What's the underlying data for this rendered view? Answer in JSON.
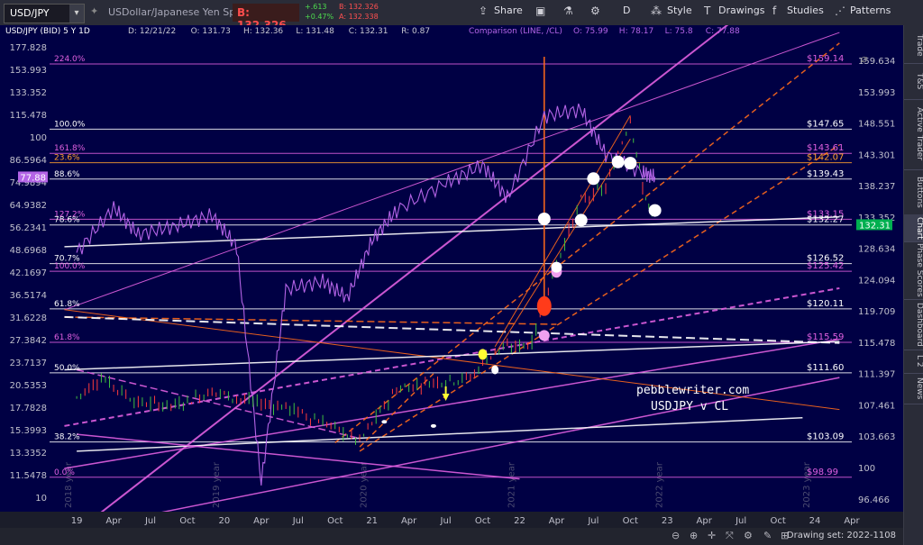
{
  "toolbar": {
    "symbol": "USD/JPY",
    "description": "USDollar/Japanese Yen Spot",
    "bid_label": "B: 132.326",
    "change_abs": "+.613",
    "change_pct": "+0.47%",
    "bid_small": "B: 132.326",
    "ask_small": "A: 132.338",
    "share_label": "Share",
    "interval_label": "D",
    "style_label": "Style",
    "drawings_label": "Drawings",
    "studies_label": "Studies",
    "patterns_label": "Patterns"
  },
  "sidebar": {
    "tabs": [
      "Trade",
      "T&S",
      "Active Trader",
      "Buttons",
      "Chart",
      "Phase Scores",
      "Dashboard",
      "L 2",
      "News"
    ]
  },
  "status": {
    "drawing_set": "Drawing set: 2022-1108"
  },
  "colors": {
    "background": "#000044",
    "price_up": "#3fbf3f",
    "price_down": "#ff3b3b",
    "comparison": "#b464e6",
    "fib_magenta": "#e060e0",
    "trend_orange": "#ff6a1a",
    "white": "#ffffff"
  },
  "chart_data": {
    "type": "line",
    "title": "USD/JPY (BID) 5 Y 1D",
    "ohlc_readout": {
      "D": "12/21/22",
      "O": "131.73",
      "H": "132.36",
      "L": "131.48",
      "C": "132.31",
      "R": "0.87"
    },
    "comparison_label": "Comparison (LINE, /CL)",
    "comparison_readout": {
      "O": "75.99",
      "H": "78.17",
      "L": "75.8",
      "C": "77.88"
    },
    "y_scale": "log",
    "x_ticks": [
      "19",
      "Apr",
      "Jul",
      "Oct",
      "20",
      "Apr",
      "Jul",
      "Oct",
      "21",
      "Apr",
      "Jul",
      "Oct",
      "22",
      "Apr",
      "Jul",
      "Oct",
      "23",
      "Apr",
      "Jul",
      "Oct",
      "24",
      "Apr"
    ],
    "year_watermarks": [
      "2018 year",
      "2019 year",
      "2020 year",
      "2021 year",
      "2022 year",
      "2023 year"
    ],
    "left_axis_ticks": [
      "177.828",
      "153.993",
      "133.352",
      "115.478",
      "100",
      "86.5964",
      "74.9894",
      "64.9382",
      "56.2341",
      "48.6968",
      "42.1697",
      "36.5174",
      "31.6228",
      "27.3842",
      "23.7137",
      "20.5353",
      "17.7828",
      "15.3993",
      "13.3352",
      "11.5478",
      "10"
    ],
    "left_axis_marker": "77.88",
    "right_axis_ticks": [
      "159.634",
      "153.993",
      "148.551",
      "143.301",
      "138.237",
      "133.352",
      "128.634",
      "124.094",
      "119.709",
      "115.478",
      "111.397",
      "107.461",
      "103.663",
      "100",
      "96.466"
    ],
    "right_axis_marker": "132.31",
    "fib_levels": [
      {
        "pct": "224.0%",
        "value": "$159.14",
        "color": "#e060e0"
      },
      {
        "pct": "100.0%",
        "value": "$147.65",
        "color": "#ffffff"
      },
      {
        "pct": "161.8%",
        "value": "$143.61",
        "color": "#e060e0"
      },
      {
        "pct": "23.6%",
        "value": "$142.07",
        "color": "#ffa030"
      },
      {
        "pct": "88.6%",
        "value": "$139.43",
        "color": "#ffffff"
      },
      {
        "pct": "127.2%",
        "value": "$133.15",
        "color": "#e060e0"
      },
      {
        "pct": "78.6%",
        "value": "$132.27",
        "color": "#ffffff"
      },
      {
        "pct": "70.7%",
        "value": "$126.52",
        "color": "#ffffff"
      },
      {
        "pct": "100.0%",
        "value": "$125.42",
        "color": "#e060e0"
      },
      {
        "pct": "61.8%",
        "value": "$120.11",
        "color": "#ffffff"
      },
      {
        "pct": "61.8%",
        "value": "$115.59",
        "color": "#e060e0"
      },
      {
        "pct": "50.0%",
        "value": "$111.60",
        "color": "#ffffff"
      },
      {
        "pct": "38.2%",
        "value": "$103.09",
        "color": "#ffffff"
      },
      {
        "pct": "0.0%",
        "value": "$98.99",
        "color": "#e060e0"
      }
    ],
    "annotation_lines": [
      "pebblewriter.com",
      "USDJPY v CL"
    ],
    "usdjpy_series": [
      {
        "x": "2019-01",
        "y": 108.5
      },
      {
        "x": "2019-03",
        "y": 111.0
      },
      {
        "x": "2019-06",
        "y": 107.8
      },
      {
        "x": "2019-09",
        "y": 107.5
      },
      {
        "x": "2019-12",
        "y": 109.3
      },
      {
        "x": "2020-03",
        "y": 108.0
      },
      {
        "x": "2020-06",
        "y": 107.3
      },
      {
        "x": "2020-09",
        "y": 105.5
      },
      {
        "x": "2020-12",
        "y": 103.2
      },
      {
        "x": "2021-03",
        "y": 109.5
      },
      {
        "x": "2021-06",
        "y": 110.5
      },
      {
        "x": "2021-09",
        "y": 111.0
      },
      {
        "x": "2021-11",
        "y": 114.5
      },
      {
        "x": "2022-02",
        "y": 115.5
      },
      {
        "x": "2022-04",
        "y": 126.5
      },
      {
        "x": "2022-06",
        "y": 136.0
      },
      {
        "x": "2022-08",
        "y": 138.0
      },
      {
        "x": "2022-10",
        "y": 149.5
      },
      {
        "x": "2022-11",
        "y": 138.0
      },
      {
        "x": "2022-12",
        "y": 132.31
      }
    ],
    "cl_series": [
      {
        "x": "2019-01",
        "y": 48.0
      },
      {
        "x": "2019-04",
        "y": 64.0
      },
      {
        "x": "2019-06",
        "y": 54.0
      },
      {
        "x": "2019-09",
        "y": 57.0
      },
      {
        "x": "2019-12",
        "y": 61.0
      },
      {
        "x": "2020-02",
        "y": 50.0
      },
      {
        "x": "2020-04",
        "y": 11.0
      },
      {
        "x": "2020-06",
        "y": 38.0
      },
      {
        "x": "2020-09",
        "y": 40.0
      },
      {
        "x": "2020-11",
        "y": 36.0
      },
      {
        "x": "2021-01",
        "y": 52.0
      },
      {
        "x": "2021-03",
        "y": 63.0
      },
      {
        "x": "2021-07",
        "y": 75.0
      },
      {
        "x": "2021-10",
        "y": 84.0
      },
      {
        "x": "2021-12",
        "y": 68.0
      },
      {
        "x": "2022-03",
        "y": 115.0
      },
      {
        "x": "2022-06",
        "y": 120.0
      },
      {
        "x": "2022-08",
        "y": 90.0
      },
      {
        "x": "2022-11",
        "y": 80.0
      },
      {
        "x": "2022-12",
        "y": 77.88
      }
    ]
  }
}
